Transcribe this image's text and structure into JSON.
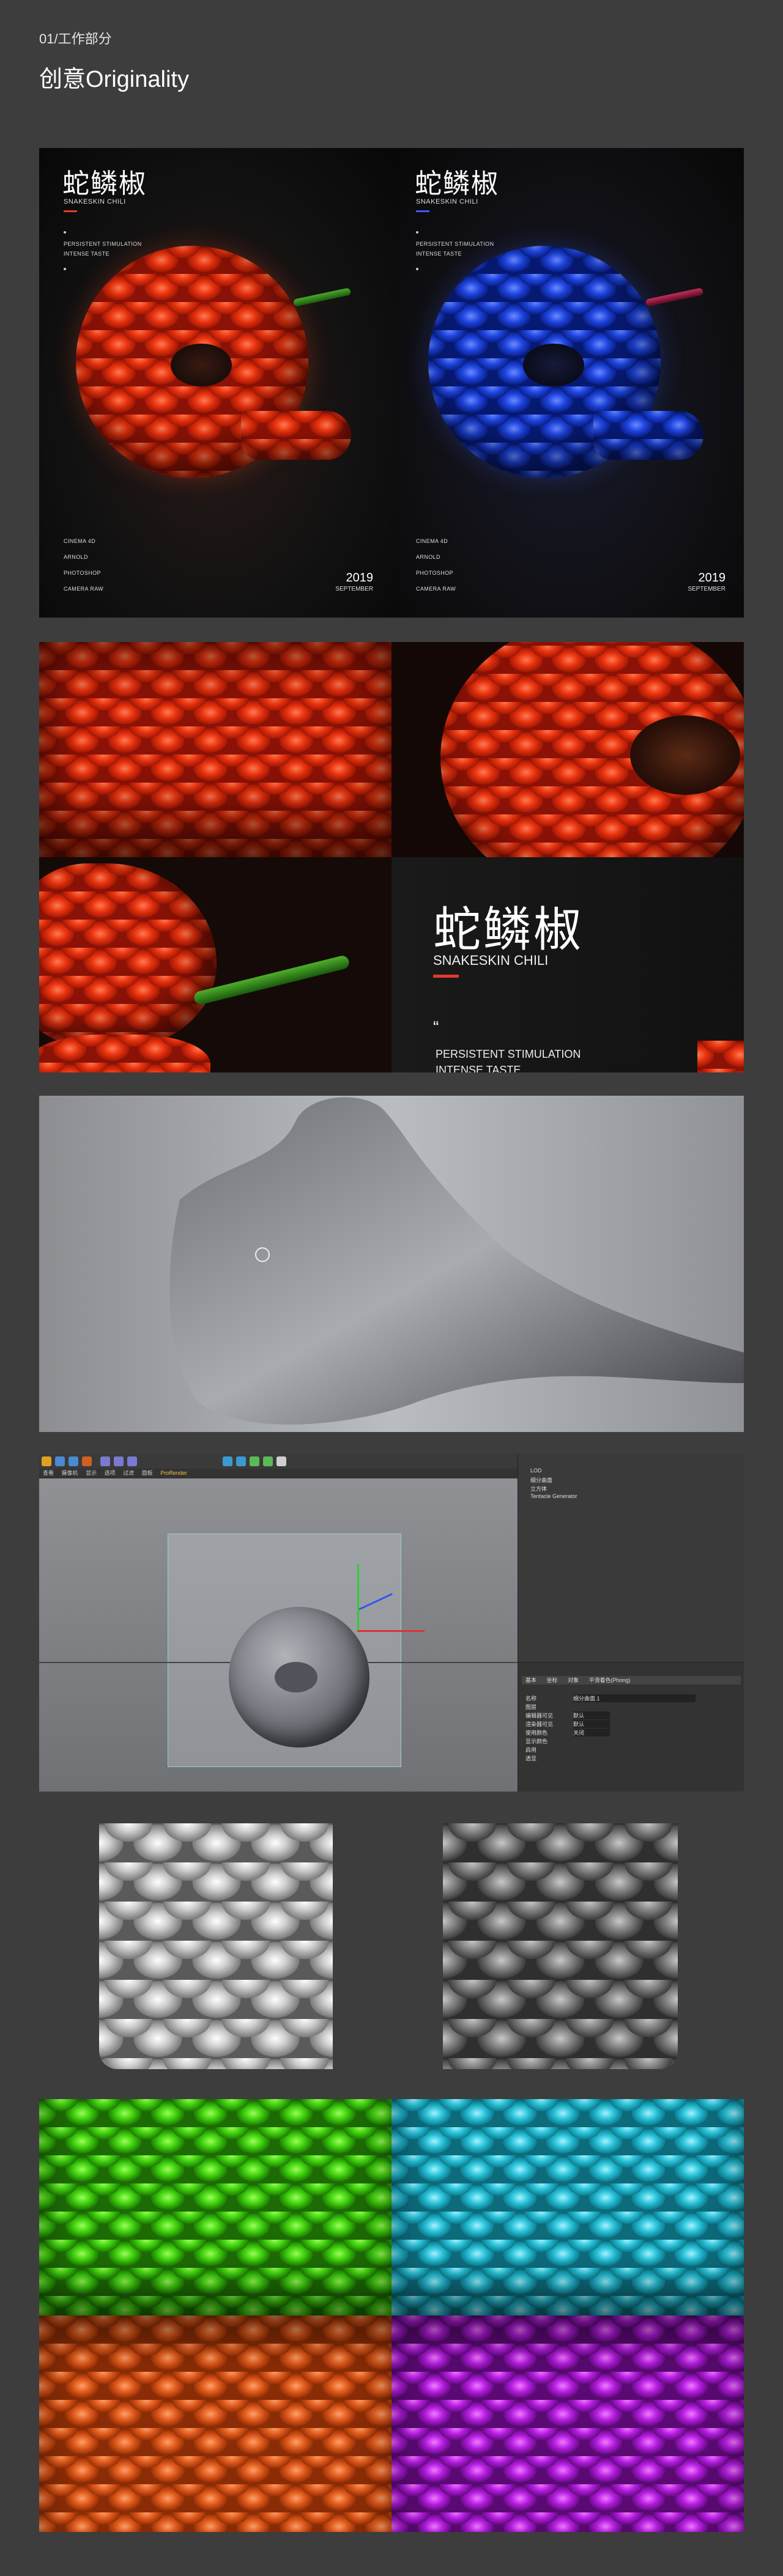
{
  "header": {
    "section": "01/工作部分",
    "title": "创意Originality"
  },
  "posters": [
    {
      "title": "蛇鳞椒",
      "subtitle": "SNAKESKIN CHILI",
      "accent": "#e23a2a",
      "tag1": "PERSISTENT STIMULATION",
      "tag2": "INTENSE TASTE",
      "tools": [
        "CINEMA 4D",
        "ARNOLD",
        "PHOTOSHOP",
        "CAMERA RAW"
      ],
      "year": "2019",
      "month": "SEPTEMBER"
    },
    {
      "title": "蛇鳞椒",
      "subtitle": "SNAKESKIN CHILI",
      "accent": "#3b5bff",
      "tag1": "PERSISTENT STIMULATION",
      "tag2": "INTENSE TASTE",
      "tools": [
        "CINEMA 4D",
        "ARNOLD",
        "PHOTOSHOP",
        "CAMERA RAW"
      ],
      "year": "2019",
      "month": "SEPTEMBER"
    }
  ],
  "detail": {
    "title": "蛇鳞椒",
    "subtitle": "SNAKESKIN CHILI",
    "quote": "“",
    "tag1": "PERSISTENT STIMULATION",
    "tag2": "INTENSE TASTE"
  },
  "c4d": {
    "menu": [
      "查看",
      "摄像机",
      "显示",
      "选项",
      "过滤",
      "面板",
      "ProRender"
    ],
    "objects": [
      "LOD",
      "细分曲面",
      "立方体",
      "Tentacle Generator"
    ],
    "attr_tabs": [
      "基本",
      "坐标",
      "对象",
      "平滑着色(Phong)"
    ],
    "attr_rows": [
      "名称",
      "图层",
      "编辑器可见",
      "渲染器可见",
      "使用颜色",
      "显示颜色",
      "启用",
      "透显"
    ],
    "attr_values": [
      "细分曲面.1",
      "",
      "默认",
      "默认",
      "关闭",
      "",
      "",
      ""
    ]
  },
  "variant_colors": [
    "green",
    "cyan",
    "orange",
    "purple"
  ]
}
